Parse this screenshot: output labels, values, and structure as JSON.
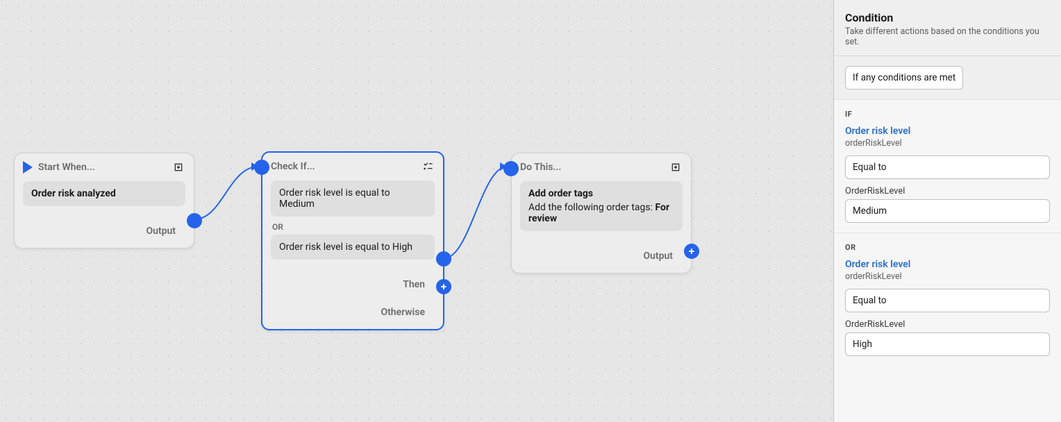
{
  "panel": {
    "title": "Condition",
    "subtitle": "Take different actions based on the conditions you set.",
    "mode_select": "If any conditions are met",
    "if_label": "IF",
    "or_label": "OR",
    "cond1": {
      "link": "Order risk level",
      "sub": "orderRiskLevel",
      "op": "Equal to",
      "field_label": "OrderRiskLevel",
      "value": "Medium"
    },
    "cond2": {
      "link": "Order risk level",
      "sub": "orderRiskLevel",
      "op": "Equal to",
      "field_label": "OrderRiskLevel",
      "value": "High"
    }
  },
  "nodes": {
    "start": {
      "title": "Start When...",
      "trigger": "Order risk analyzed",
      "output_label": "Output"
    },
    "check": {
      "title": "Check If...",
      "cond1": "Order risk level is equal to Medium",
      "or": "OR",
      "cond2": "Order risk level is equal to High",
      "then_label": "Then",
      "otherwise_label": "Otherwise"
    },
    "action": {
      "title": "Do This...",
      "action_title": "Add order tags",
      "desc_prefix": "Add the following order tags: ",
      "desc_tag": "For review",
      "output_label": "Output"
    }
  }
}
